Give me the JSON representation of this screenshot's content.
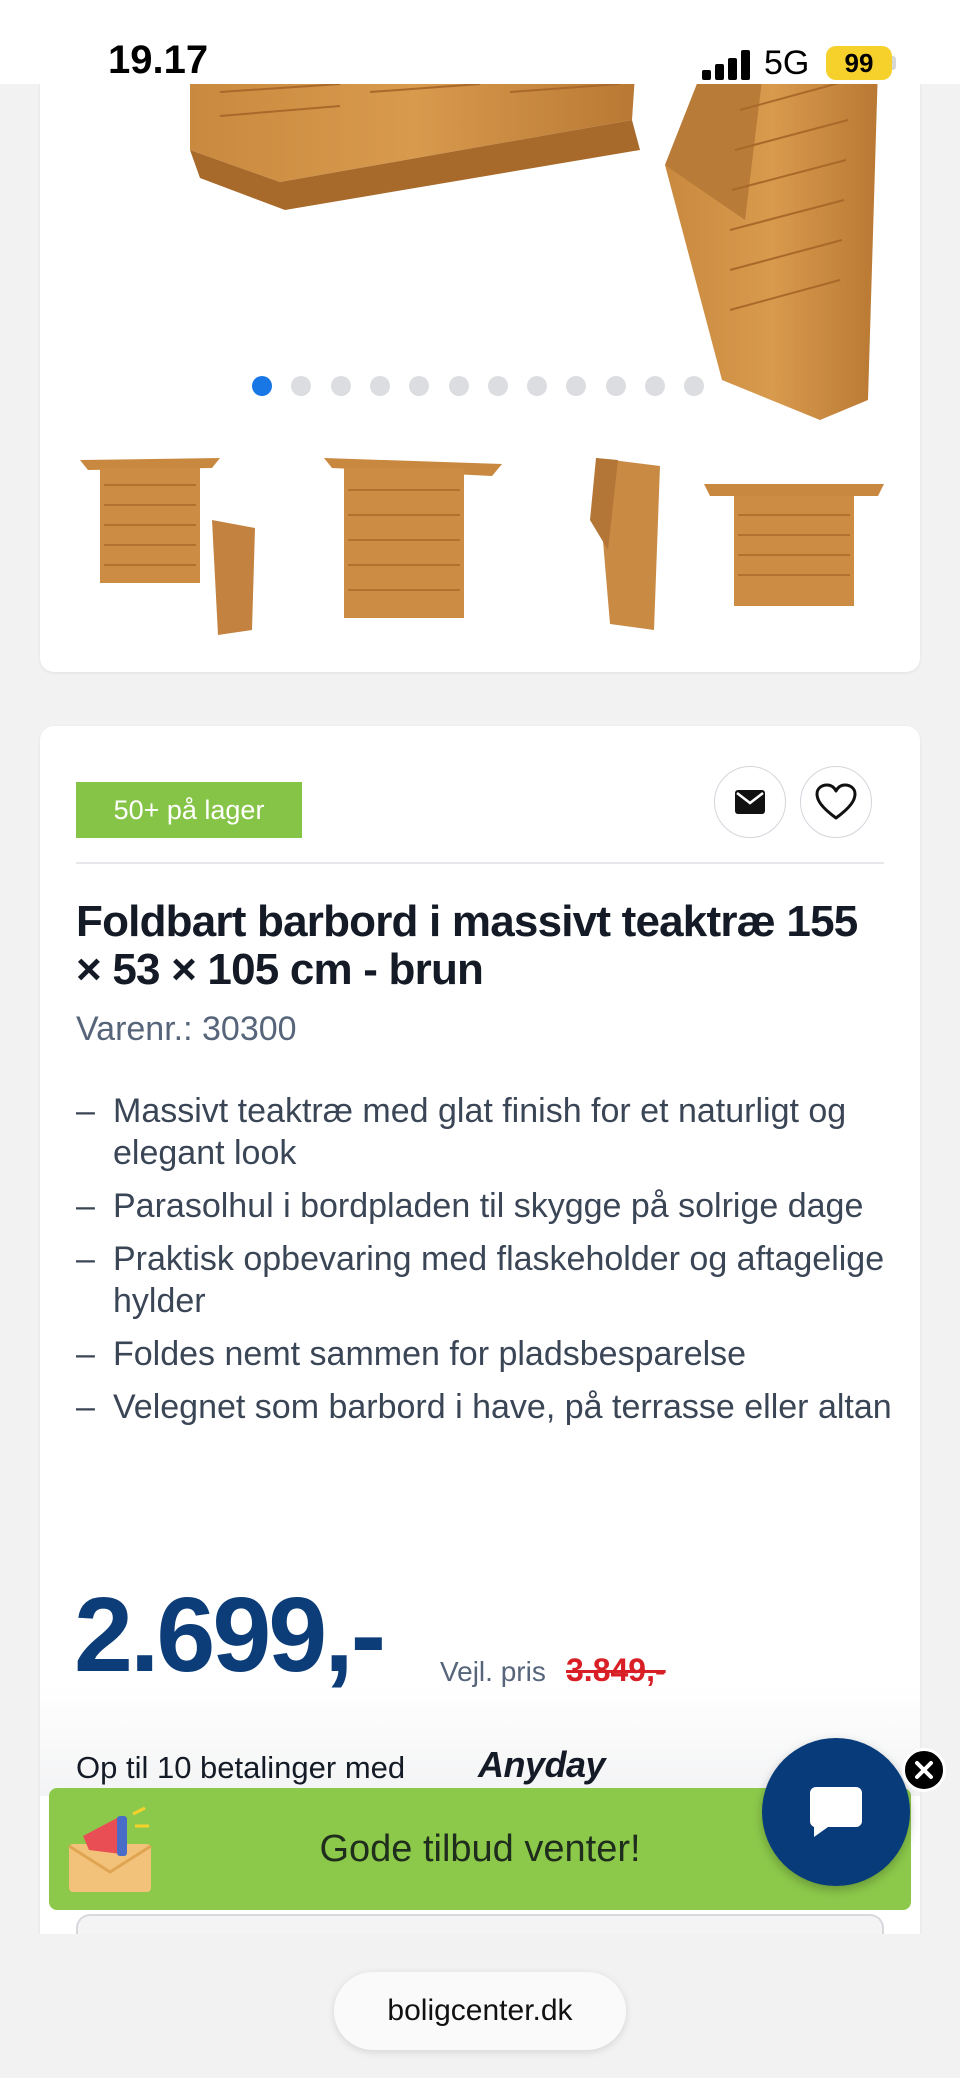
{
  "status_bar": {
    "time": "19.17",
    "network": "5G",
    "battery": "99"
  },
  "gallery": {
    "dot_count": 12,
    "active_dot": 0,
    "thumbnail_count": 4
  },
  "product": {
    "stock_badge": "50+ på lager",
    "title": "Foldbart barbord i massivt teaktræ 155 × 53 × 105 cm - brun",
    "sku_label": "Varenr.:",
    "sku": "30300",
    "features": [
      "Massivt teaktræ med glat finish for et naturligt og elegant look",
      "Parasolhul i bordpladen til skygge på solrige dage",
      "Praktisk opbevaring med flaskeholder og aftagelige hylder",
      "Foldes nemt sammen for pladsbesparelse",
      "Velegnet som barbord i have, på terrasse eller altan"
    ],
    "price": "2.699,-",
    "recommended_label": "Vejl. pris",
    "recommended_price": "3.849,-",
    "installments_text": "Op til 10 betalinger med",
    "installments_provider": "Anyday",
    "feature_dash": "–"
  },
  "offer_banner": {
    "text": "Gode tilbud venter!"
  },
  "browser": {
    "url": "boligcenter.dk"
  },
  "colors": {
    "stock_green": "#85c446",
    "price_blue": "#0c3d78",
    "strike_red": "#d91f26",
    "banner_green": "#8cc94a",
    "chat_blue": "#073b7a",
    "dot_active": "#1877e5"
  }
}
